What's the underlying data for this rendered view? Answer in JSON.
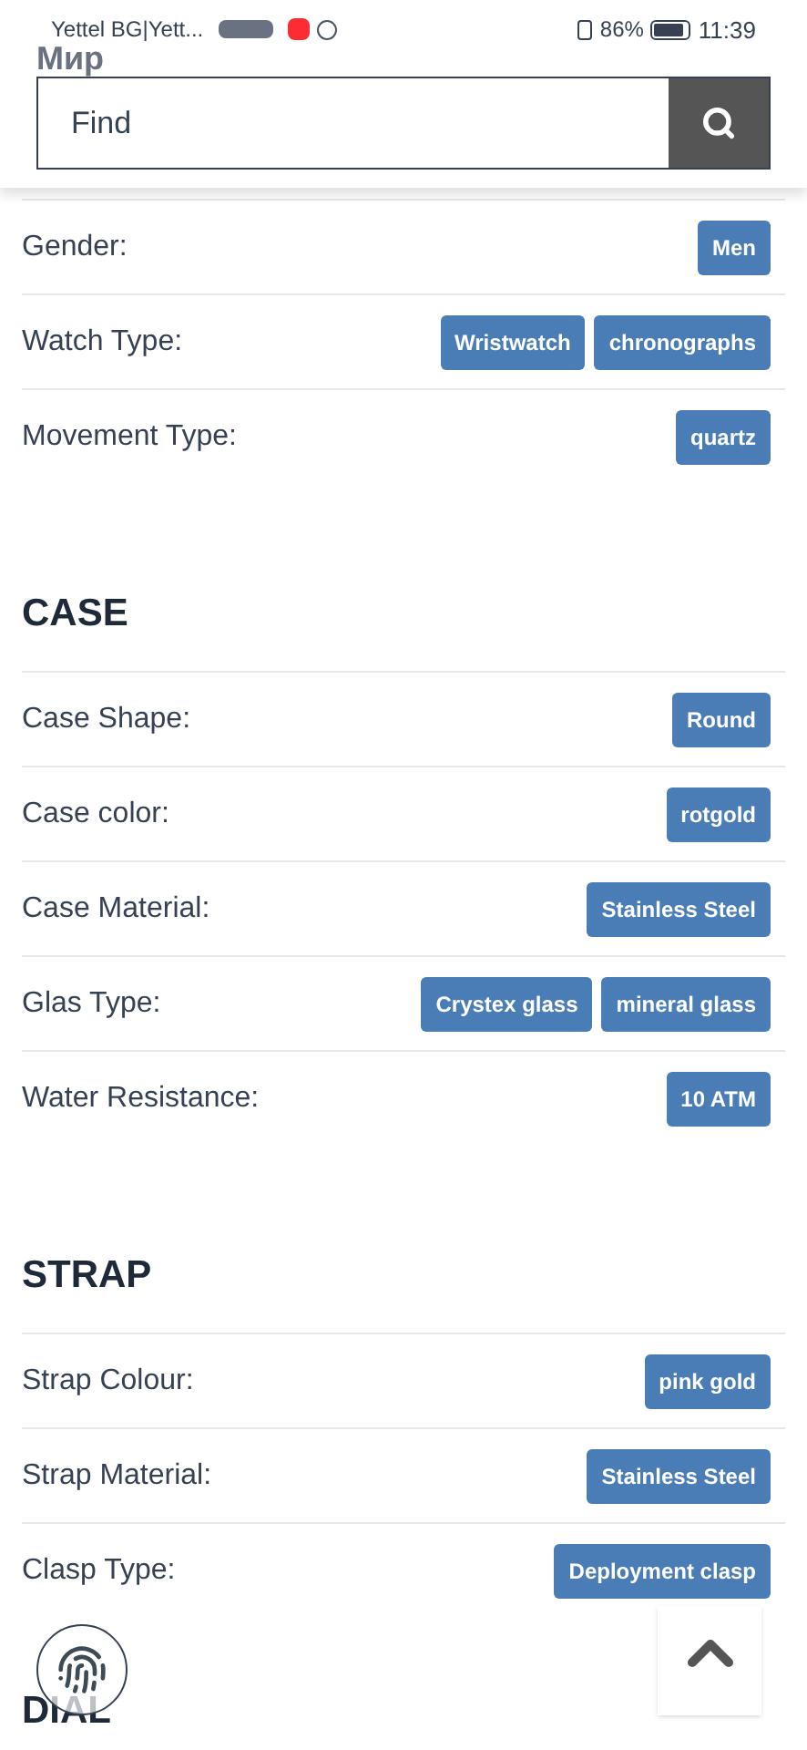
{
  "status_bar": {
    "carrier": "Yettel BG|Yett...",
    "battery": "86%",
    "time": "11:39"
  },
  "behind_header": "Мир",
  "search": {
    "placeholder": "Find"
  },
  "sections": [
    {
      "rows": [
        {
          "label": "Gender:",
          "tags": [
            "Men"
          ]
        },
        {
          "label": "Watch Type:",
          "tags": [
            "Wristwatch",
            "chronographs"
          ]
        },
        {
          "label": "Movement Type:",
          "tags": [
            "quartz"
          ]
        }
      ]
    },
    {
      "title": "CASE",
      "rows": [
        {
          "label": "Case Shape:",
          "tags": [
            "Round"
          ]
        },
        {
          "label": "Case color:",
          "tags": [
            "rotgold"
          ]
        },
        {
          "label": "Case Material:",
          "tags": [
            "Stainless Steel"
          ]
        },
        {
          "label": "Glas Type:",
          "tags": [
            "Crystex glass",
            "mineral glass"
          ]
        },
        {
          "label": "Water Resistance:",
          "tags": [
            "10 ATM"
          ]
        }
      ]
    },
    {
      "title": "STRAP",
      "rows": [
        {
          "label": "Strap Colour:",
          "tags": [
            "pink gold"
          ]
        },
        {
          "label": "Strap Material:",
          "tags": [
            "Stainless Steel"
          ]
        },
        {
          "label": "Clasp Type:",
          "tags": [
            "Deployment clasp"
          ]
        }
      ]
    },
    {
      "title": "DIAL"
    }
  ]
}
